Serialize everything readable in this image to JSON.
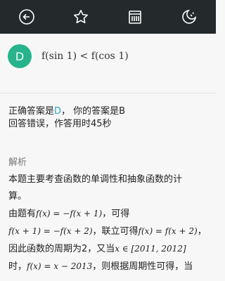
{
  "toolbar": {
    "icons": [
      "back-icon",
      "star-icon",
      "answer-card-icon",
      "night-mode-icon"
    ]
  },
  "question": {
    "option_letter": "D",
    "option_formula": "f(sin 1) < f(cos 1)"
  },
  "result": {
    "correct_prefix": "正确答案是",
    "correct_answer": "D",
    "your_prefix": "，  你的答案是",
    "your_answer": "B",
    "status_line": "回答错误，作答用时45秒"
  },
  "analysis": {
    "label": "解析",
    "line1": "本题主要考查函数的单调性和抽象函数的计",
    "line2": "算。",
    "line3_text": "由题有",
    "line3_math": "f(x) = −f(x + 1)",
    "line3_tail": "，可得",
    "line4_math1": "f(x + 1) = −f(x + 2)",
    "line4_mid": "，联立可得",
    "line4_math2": "f(x) = f(x + 2)",
    "line4_tail": "，",
    "line5_text": "因此函数的周期为2，又当",
    "line5_math": "x ∈ [2011, 2012]",
    "line6_text": "时，",
    "line6_math": "f(x) = x − 2013",
    "line6_tail": "，则根据周期性可得，当"
  }
}
